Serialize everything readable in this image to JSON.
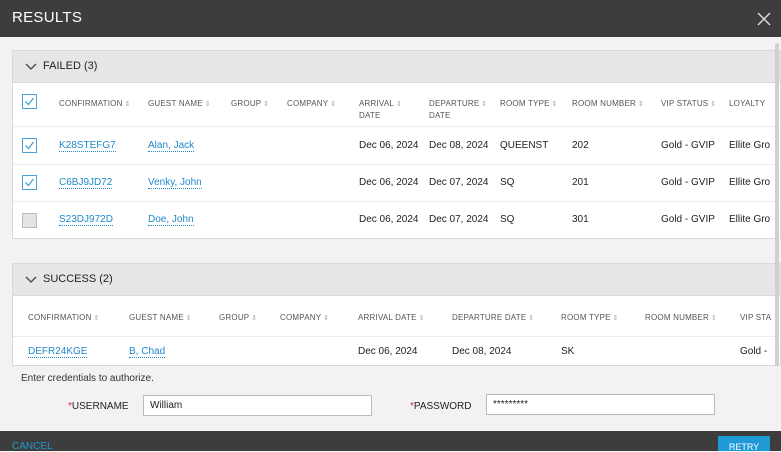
{
  "dialog": {
    "title": "RESULTS"
  },
  "failed": {
    "title": "FAILED (3)",
    "columns": [
      "CONFIRMATION",
      "GUEST NAME",
      "GROUP",
      "COMPANY",
      "ARRIVAL",
      "DATE",
      "DEPARTURE",
      "DATE",
      "ROOM TYPE",
      "ROOM NUMBER",
      "VIP STATUS",
      "LOYALTY"
    ],
    "rows": [
      {
        "checked": true,
        "confirmation": "K28STEFG7",
        "guest": "Alan, Jack",
        "arrival": "Dec 06, 2024",
        "departure": "Dec 08, 2024",
        "room_type": "QUEENST",
        "room_number": "202",
        "vip": "Gold - GVIP",
        "loyalty": "Ellite Gro"
      },
      {
        "checked": true,
        "confirmation": "C6BJ9JD72",
        "guest": "Venky, John",
        "arrival": "Dec 06, 2024",
        "departure": "Dec 07, 2024",
        "room_type": "SQ",
        "room_number": "201",
        "vip": "Gold - GVIP",
        "loyalty": "Ellite Gro"
      },
      {
        "checked": false,
        "confirmation": "S23DJ972D",
        "guest": "Doe, John",
        "arrival": "Dec 06, 2024",
        "departure": "Dec 07, 2024",
        "room_type": "SQ",
        "room_number": "301",
        "vip": "Gold - GVIP",
        "loyalty": "Ellite Gro"
      }
    ]
  },
  "success": {
    "title": "SUCCESS (2)",
    "columns": [
      "CONFIRMATION",
      "GUEST NAME",
      "GROUP",
      "COMPANY",
      "ARRIVAL DATE",
      "DEPARTURE DATE",
      "ROOM TYPE",
      "ROOM NUMBER",
      "VIP STA"
    ],
    "rows": [
      {
        "confirmation": "DEFR24KGE",
        "guest": "B, Chad",
        "arrival": "Dec 06, 2024",
        "departure": "Dec 08, 2024",
        "room_type": "SK",
        "vip": "Gold -"
      }
    ]
  },
  "auth": {
    "message": "Enter credentials to authorize.",
    "required_mark": "*",
    "username_label": "USERNAME",
    "username_value": "William",
    "password_label": "PASSWORD",
    "password_value": "*********"
  },
  "footer": {
    "cancel": "CANCEL",
    "retry": "RETRY"
  },
  "colors": {
    "accent": "#1f9ad6",
    "titlebar": "#3d3d3d"
  }
}
